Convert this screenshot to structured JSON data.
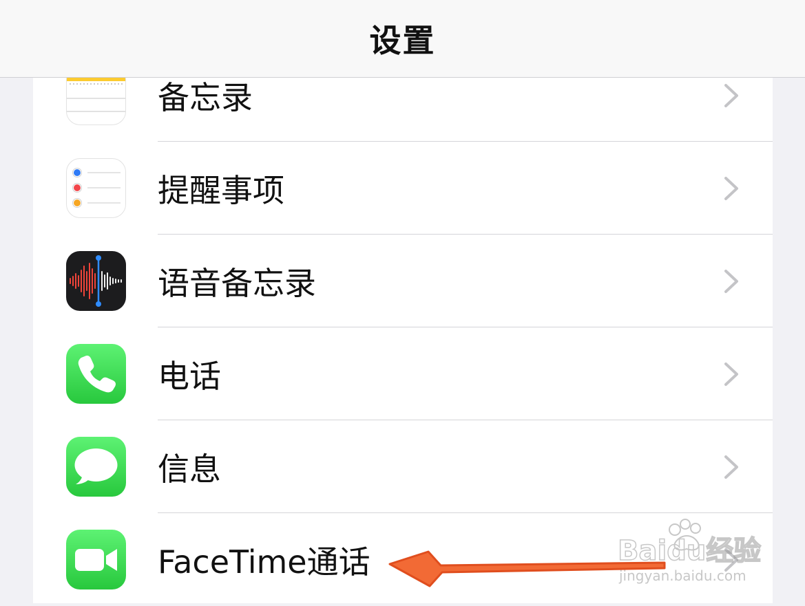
{
  "navbar": {
    "title": "设置"
  },
  "rows": [
    {
      "label": "备忘录",
      "icon": "notes-icon"
    },
    {
      "label": "提醒事项",
      "icon": "reminders-icon"
    },
    {
      "label": "语音备忘录",
      "icon": "voice-memos-icon"
    },
    {
      "label": "电话",
      "icon": "phone-icon"
    },
    {
      "label": "信息",
      "icon": "messages-icon"
    },
    {
      "label": "FaceTime通话",
      "icon": "facetime-icon"
    }
  ],
  "watermark": {
    "brand": "Baidu经验",
    "url": "jingyan.baidu.com"
  },
  "colors": {
    "arrow": "#f0642f",
    "green": "#34c759",
    "chevron": "#c4c4c7"
  }
}
